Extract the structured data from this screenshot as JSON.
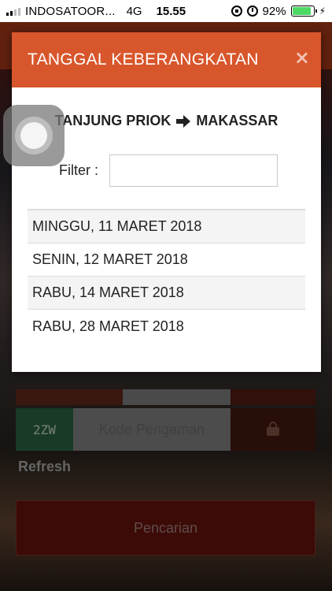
{
  "status_bar": {
    "carrier": "INDOSATOOR...",
    "network": "4G",
    "time": "15.55",
    "battery": "92%",
    "battery_level": 0.92
  },
  "background": {
    "captcha_text": "2ZW",
    "captcha_placeholder": "Kode Pengaman",
    "refresh_label": "Refresh",
    "search_label": "Pencarian"
  },
  "modal": {
    "title": "TANGGAL KEBERANGKATAN",
    "close_label": "×",
    "route": {
      "origin": "TANJUNG PRIOK",
      "destination": "MAKASSAR"
    },
    "filter_label": "Filter :",
    "filter_value": "",
    "dates": [
      "MINGGU, 11 MARET 2018",
      "SENIN, 12 MARET 2018",
      "RABU, 14 MARET 2018",
      "RABU, 28 MARET 2018"
    ]
  },
  "colors": {
    "header": "#d8562b",
    "search_button": "#6e1410",
    "battery_fill": "#4cd964"
  }
}
